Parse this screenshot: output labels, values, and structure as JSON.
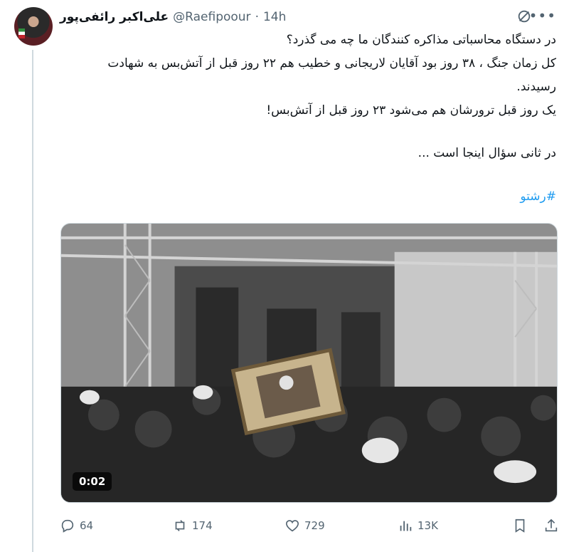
{
  "author": {
    "name": "علی‌اکبر رائفی‌پور",
    "handle": "@Raefipoour",
    "separator": "·",
    "time": "14h"
  },
  "tweet": {
    "lines": [
      "در دستگاه محاسباتی مذاکره کنندگان ما چه می گذرد؟",
      "کل زمان جنگ ، ۳۸ روز بود آقایان لاریجانی و خطیب هم ۲۲ روز قبل از آتش‌بس به شهادت",
      "رسیدند.",
      "یک روز قبل ترورشان هم می‌شود ۲۳ روز قبل از آتش‌بس!",
      "در ثانی سؤال اینجا است ..."
    ],
    "hashtag": "#رشتو"
  },
  "video": {
    "timestamp": "0:02"
  },
  "actions": {
    "replies": "64",
    "retweets": "174",
    "likes": "729",
    "views": "13K"
  },
  "icons": [
    "grok-icon",
    "more-icon",
    "reply-icon",
    "retweet-icon",
    "like-icon",
    "views-icon",
    "bookmark-icon",
    "share-icon"
  ],
  "colors": {
    "text": "#0f1419",
    "muted": "#536471",
    "link": "#1d9bf0"
  }
}
